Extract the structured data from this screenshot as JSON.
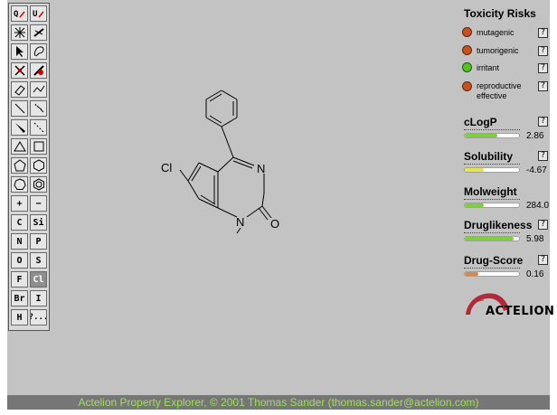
{
  "toolbar": {
    "row1": [
      "Q",
      "U"
    ],
    "row_atoms": [
      {
        "left": "C",
        "right": "Si"
      },
      {
        "left": "N",
        "right": "P"
      },
      {
        "left": "O",
        "right": "S"
      },
      {
        "left": "F",
        "right": "Cl"
      },
      {
        "left": "Br",
        "right": "I"
      },
      {
        "left": "H",
        "right": "?..."
      }
    ],
    "plus": "+",
    "minus": "−"
  },
  "molecule": {
    "atoms": [
      "Cl",
      "N",
      "N",
      "O"
    ]
  },
  "toxicity": {
    "header": "Toxicity Risks",
    "help": "?",
    "items": [
      {
        "label": "mutagenic",
        "level": "high",
        "color": "#c8521e"
      },
      {
        "label": "tumorigenic",
        "level": "high",
        "color": "#c8521e"
      },
      {
        "label": "irritant",
        "level": "none",
        "color": "#55c322"
      },
      {
        "label": "reproductive effective",
        "line1": "reproductive",
        "line2": "effective",
        "level": "high",
        "color": "#c8521e"
      }
    ]
  },
  "properties": [
    {
      "title": "cLogP",
      "help": "?",
      "value": "2.86",
      "fill": 0.6,
      "color": "#7ccf3f"
    },
    {
      "title": "Solubility",
      "help": "?",
      "value": "-4.67",
      "fill": 0.35,
      "color": "#e6e64a"
    },
    {
      "title": "Molweight",
      "help": "",
      "value": "284.0",
      "fill": 0.35,
      "color": "#7ccf3f"
    },
    {
      "title": "Druglikeness",
      "help": "?",
      "value": "5.98",
      "fill": 0.9,
      "color": "#7ccf3f"
    },
    {
      "title": "Drug-Score",
      "help": "?",
      "value": "0.16",
      "fill": 0.25,
      "color": "#d98a4a"
    }
  ],
  "logo": {
    "text": "ACTELION"
  },
  "statusbar": {
    "text": "Actelion Property Explorer, © 2001 Thomas Sander (thomas.sander@actelion.com)"
  }
}
